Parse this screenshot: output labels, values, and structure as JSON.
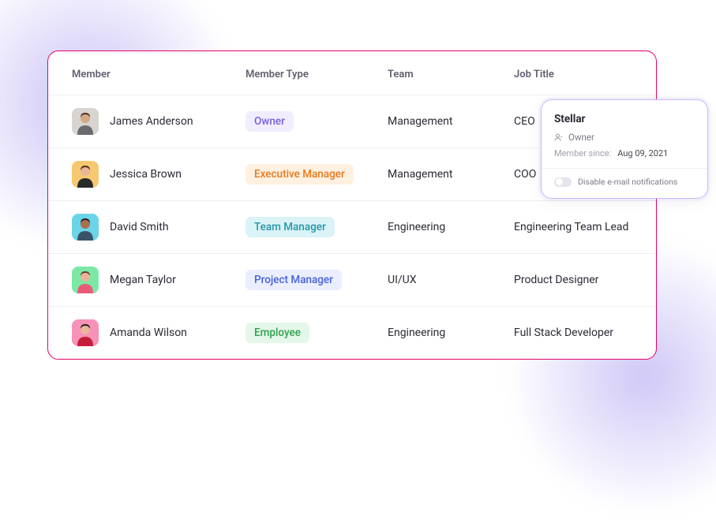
{
  "headers": {
    "member": "Member",
    "member_type": "Member Type",
    "team": "Team",
    "job_title": "Job Title"
  },
  "rows": [
    {
      "name": "James Anderson",
      "type": "Owner",
      "type_class": "badge-owner",
      "team": "Management",
      "title": "CEO",
      "avatar_bg": "#d8d4cf",
      "avatar_skin": "#d4a884",
      "avatar_hair": "#4a3628",
      "avatar_shirt": "#6a6a70"
    },
    {
      "name": "Jessica Brown",
      "type": "Executive Manager",
      "type_class": "badge-exec",
      "team": "Management",
      "title": "COO",
      "avatar_bg": "#f7c872",
      "avatar_skin": "#e8b698",
      "avatar_hair": "#4a2e1a",
      "avatar_shirt": "#2a2a2a"
    },
    {
      "name": "David Smith",
      "type": "Team Manager",
      "type_class": "badge-team",
      "team": "Engineering",
      "title": "Engineering Team Lead",
      "avatar_bg": "#6cd4e8",
      "avatar_skin": "#a87250",
      "avatar_hair": "#2a2018",
      "avatar_shirt": "#3a5268"
    },
    {
      "name": "Megan Taylor",
      "type": "Project Manager",
      "type_class": "badge-proj",
      "team": "UI/UX",
      "title": "Product Designer",
      "avatar_bg": "#7de8a6",
      "avatar_skin": "#e8b698",
      "avatar_hair": "#6a4432",
      "avatar_shirt": "#e85c7a"
    },
    {
      "name": "Amanda Wilson",
      "type": "Employee",
      "type_class": "badge-emp",
      "team": "Engineering",
      "title": "Full Stack Developer",
      "avatar_bg": "#f792b8",
      "avatar_skin": "#e8b698",
      "avatar_hair": "#2a2018",
      "avatar_shirt": "#c41e3a"
    }
  ],
  "detail": {
    "name": "Stellar",
    "role": "Owner",
    "since_label": "Member since:",
    "since_value": "Aug 09, 2021",
    "toggle_label": "Disable e-mail notifications"
  }
}
